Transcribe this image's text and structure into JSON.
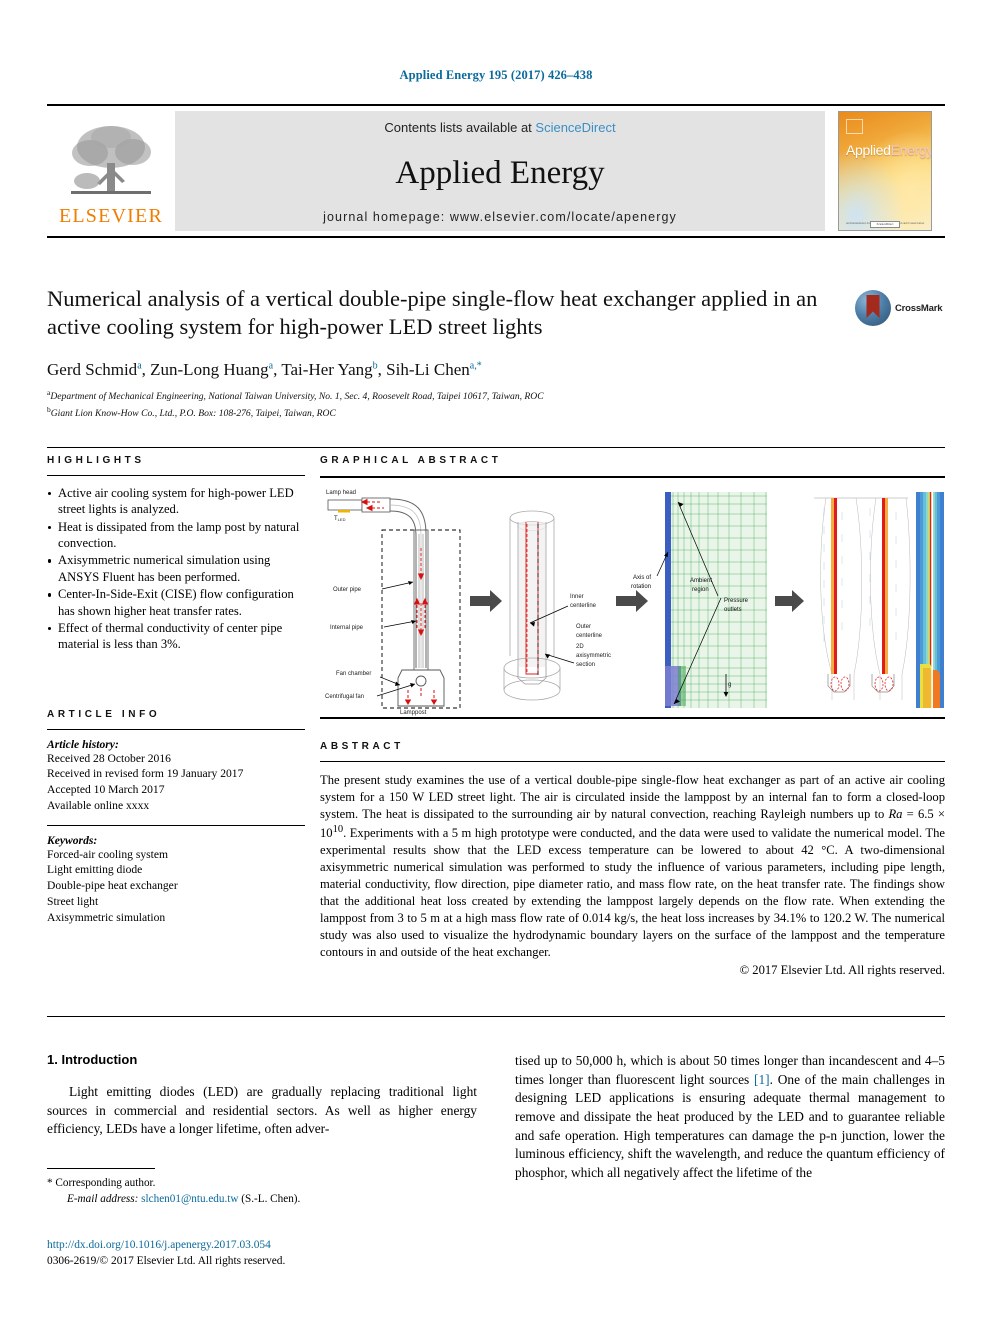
{
  "running_head": "Applied Energy 195 (2017) 426–438",
  "masthead": {
    "publisher_logo_label": "ELSEVIER",
    "contents_prefix": "Contents lists available at ",
    "contents_link": "ScienceDirect",
    "journal_name": "Applied Energy",
    "homepage": "journal homepage: www.elsevier.com/locate/apenergy",
    "cover": {
      "title_part1": "Applied",
      "title_part2": "Energy",
      "footer_line": "An International Journal of Energy Conversion and Conservation",
      "footer_badge": "ScienceDirect"
    }
  },
  "article": {
    "title": "Numerical analysis of a vertical double-pipe single-flow heat exchanger applied in an active cooling system for high-power LED street lights",
    "crossmark_label": "CrossMark",
    "authors": [
      {
        "name": "Gerd Schmid",
        "sup": "a",
        "sep": ", "
      },
      {
        "name": "Zun-Long Huang",
        "sup": "a",
        "sep": ", "
      },
      {
        "name": "Tai-Her Yang",
        "sup": "b",
        "sep": ", "
      },
      {
        "name": "Sih-Li Chen",
        "sup": "a,*",
        "sep": ""
      }
    ],
    "affiliations": [
      {
        "marker": "a",
        "text": "Department of Mechanical Engineering, National Taiwan University, No. 1, Sec. 4, Roosevelt Road, Taipei 10617, Taiwan, ROC"
      },
      {
        "marker": "b",
        "text": "Giant Lion Know-How Co., Ltd., P.O. Box: 108-276, Taipei, Taiwan, ROC"
      }
    ]
  },
  "highlights": {
    "heading": "HIGHLIGHTS",
    "items": [
      "Active air cooling system for high-power LED street lights is analyzed.",
      "Heat is dissipated from the lamp post by natural convection.",
      "Axisymmetric numerical simulation using ANSYS Fluent has been performed.",
      "Center-In-Side-Exit (CISE) flow configuration has shown higher heat transfer rates.",
      "Effect of thermal conductivity of center pipe material is less than 3%."
    ]
  },
  "graphical_abstract": {
    "heading": "GRAPHICAL ABSTRACT",
    "labels": {
      "lamp_head": "Lamp head",
      "t_led": "TLED",
      "outer_pipe": "Outer pipe",
      "internal_pipe": "Internal pipe",
      "fan_chamber": "Fan chamber",
      "centrifugal_fan": "Centrifugal fan",
      "lamppost": "Lamppost",
      "inner_centerline": "Inner centerline",
      "outer_centerline": "Outer centerline",
      "axisymmetric_section": "2D axisymmetric section",
      "axis_of_rotation": "Axis of rotation",
      "ambient_region": "Ambient region",
      "pressure_outlets": "Pressure outlets",
      "g_label": "g"
    }
  },
  "article_info": {
    "heading": "ARTICLE INFO",
    "history_label": "Article history:",
    "history": [
      "Received 28 October 2016",
      "Received in revised form 19 January 2017",
      "Accepted 10 March 2017",
      "Available online xxxx"
    ],
    "keywords_label": "Keywords:",
    "keywords": [
      "Forced-air cooling system",
      "Light emitting diode",
      "Double-pipe heat exchanger",
      "Street light",
      "Axisymmetric simulation"
    ]
  },
  "abstract": {
    "heading": "ABSTRACT",
    "paragraph_1": "The present study examines the use of a vertical double-pipe single-flow heat exchanger as part of an active air cooling system for a 150 W LED street light. The air is circulated inside the lamppost by an internal fan to form a closed-loop system. The heat is dissipated to the surrounding air by natural convection, reaching Rayleigh numbers up to ",
    "rayleigh_italic": "Ra",
    "rayleigh_value": " = 6.5 × 10",
    "rayleigh_exp": "10",
    "paragraph_2": ". Experiments with a 5 m high prototype were conducted, and the data were used to validate the numerical model. The experimental results show that the LED excess temperature can be lowered to about 42 °C. A two-dimensional axisymmetric numerical simulation was performed to study the influence of various parameters, including pipe length, material conductivity, flow direction, pipe diameter ratio, and mass flow rate, on the heat transfer rate. The findings show that the additional heat loss created by extending the lamppost largely depends on the flow rate. When extending the lamppost from 3 to 5 m at a high mass flow rate of 0.014 kg/s, the heat loss increases by 34.1% to 120.2 W. The numerical study was also used to visualize the hydrodynamic boundary layers on the surface of the lamppost and the temperature contours in and outside of the heat exchanger.",
    "copyright": "© 2017 Elsevier Ltd. All rights reserved."
  },
  "introduction": {
    "heading": "1. Introduction",
    "column_left": "Light emitting diodes (LED) are gradually replacing traditional light sources in commercial and residential sectors. As well as higher energy efficiency, LEDs have a longer lifetime, often adver-",
    "column_right_part1": "tised up to 50,000 h, which is about 50 times longer than incandescent and 4–5 times longer than fluorescent light sources ",
    "column_right_ref": "[1]",
    "column_right_part2": ". One of the main challenges in designing LED applications is ensuring adequate thermal management to remove and dissipate the heat produced by the LED and to guarantee reliable and safe operation. High temperatures can damage the p-n junction, lower the luminous efficiency, shift the wavelength, and reduce the quantum efficiency of phosphor, which all negatively affect the lifetime of the"
  },
  "footnote": {
    "corresponding_marker": "*",
    "corresponding_text": "Corresponding author.",
    "email_label": "E-mail address:",
    "email": "slchen01@ntu.edu.tw",
    "email_owner": "(S.-L. Chen)."
  },
  "footer": {
    "doi": "http://dx.doi.org/10.1016/j.apenergy.2017.03.054",
    "issn_line": "0306-2619/© 2017 Elsevier Ltd. All rights reserved."
  },
  "colors": {
    "link_blue": "#0b6a9c",
    "sciencedirect_blue": "#3a8fc4",
    "elsevier_orange": "#f07d00",
    "masthead_gray": "#e3e3e3"
  }
}
